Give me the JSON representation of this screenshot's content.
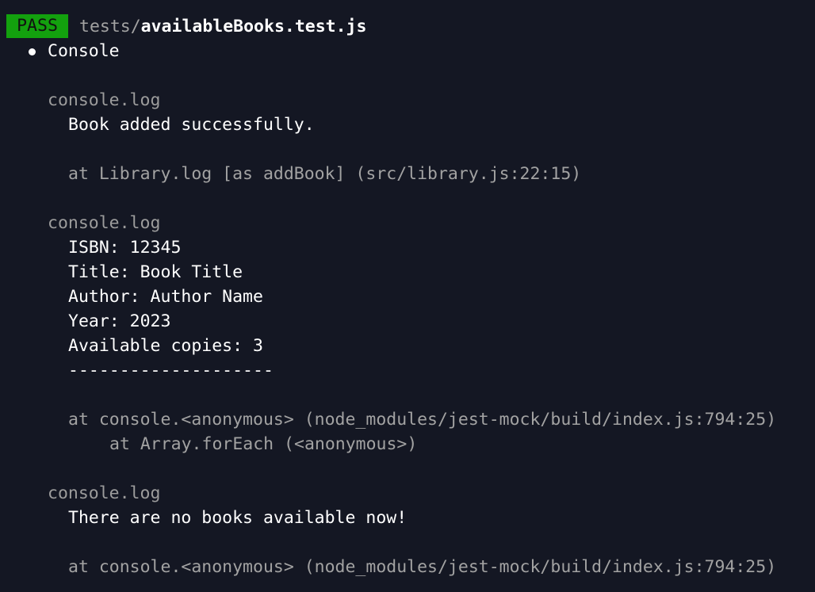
{
  "header": {
    "status": "PASS",
    "test_dir": "tests/",
    "test_file": "availableBooks.test.js"
  },
  "console_section": {
    "title": "Console"
  },
  "logs": [
    {
      "label": "console.log",
      "lines": [
        "Book added successfully."
      ],
      "trace": [
        "at Library.log [as addBook] (src/library.js:22:15)"
      ]
    },
    {
      "label": "console.log",
      "lines": [
        "ISBN: 12345",
        "Title: Book Title",
        "Author: Author Name",
        "Year: 2023",
        "Available copies: 3",
        "--------------------"
      ],
      "trace": [
        "at console.<anonymous> (node_modules/jest-mock/build/index.js:794:25)",
        "at Array.forEach (<anonymous>)"
      ]
    },
    {
      "label": "console.log",
      "lines": [
        "There are no books available now!"
      ],
      "trace": [
        "at console.<anonymous> (node_modules/jest-mock/build/index.js:794:25)"
      ]
    }
  ],
  "colors": {
    "background": "#141723",
    "pass_badge": "#13a10e",
    "dim_text": "#a2a2a2",
    "bright_text": "#ffffff"
  }
}
